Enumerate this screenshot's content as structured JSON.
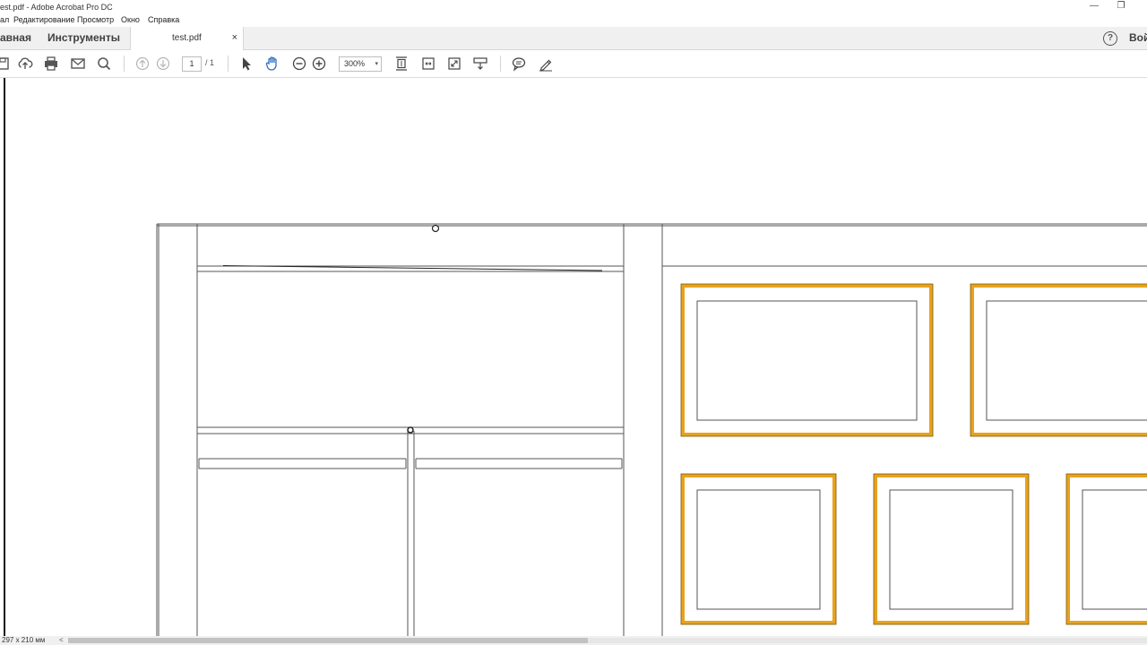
{
  "window": {
    "title": "est.pdf - Adobe Acrobat Pro DC",
    "minimize_glyph": "—",
    "restore_glyph": "❐"
  },
  "menu": [
    "ал",
    "Редактирование",
    "Просмотр",
    "Окно",
    "Справка"
  ],
  "tabs": {
    "home": "авная",
    "tools": "Инструменты",
    "document": "test.pdf",
    "close_glyph": "×"
  },
  "help_label": "?",
  "signin_label": "Вой",
  "toolbar": {
    "page_current": "1",
    "page_total": "/ 1",
    "zoom_value": "300%",
    "zoom_arrow": "▾"
  },
  "status": {
    "page_size": "297 x 210 мм",
    "scroll_left": "<"
  },
  "colors": {
    "frame_gold": "#e8a21c",
    "hand_tool_blue": "#2d6fc4",
    "line": "#555555"
  }
}
